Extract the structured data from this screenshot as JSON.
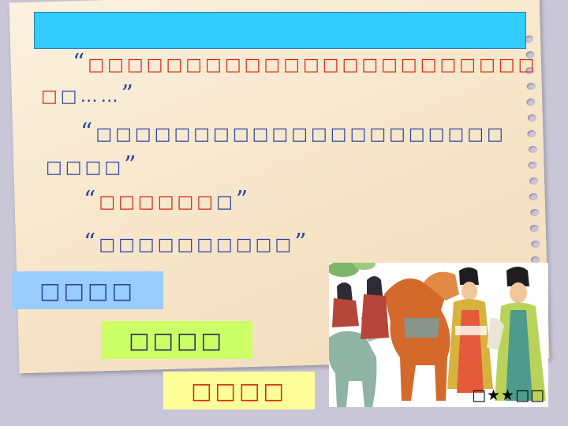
{
  "paragraph1": {
    "open_quote": "“",
    "red_text": "□□□□□□□□□□□□□□□□□□□□□□□",
    "red_text2": "□",
    "blue_text": "□……",
    "close_quote": "”"
  },
  "paragraph2": {
    "open_quote": "“",
    "blue_text": "□□□□□□□□□□□□□□□□□□□□□",
    "blue_text2": "□□□□",
    "close_quote": "”"
  },
  "paragraph3": {
    "open_quote": "“",
    "red_text": "□□□□□□",
    "blue_text": "□",
    "close_quote": "”"
  },
  "paragraph4": {
    "open_quote": "“",
    "blue_text": "□□□□□□□□□□",
    "close_quote": "”"
  },
  "labels": [
    {
      "text": "□□□□",
      "bg": "#99ccff",
      "color": "#2b45a0"
    },
    {
      "text": "□□□□",
      "bg": "#ccff66",
      "color": "#1f2f5a"
    },
    {
      "text": "□□□□",
      "bg": "#ffff99",
      "color": "#d52b12"
    }
  ],
  "illustration": {
    "caption_before": "□",
    "caption_stars": "★★",
    "caption_after": "□□"
  },
  "colors": {
    "title_bar": "#33ccff",
    "red_text": "#d52b12",
    "blue_text": "#2b45a0"
  }
}
